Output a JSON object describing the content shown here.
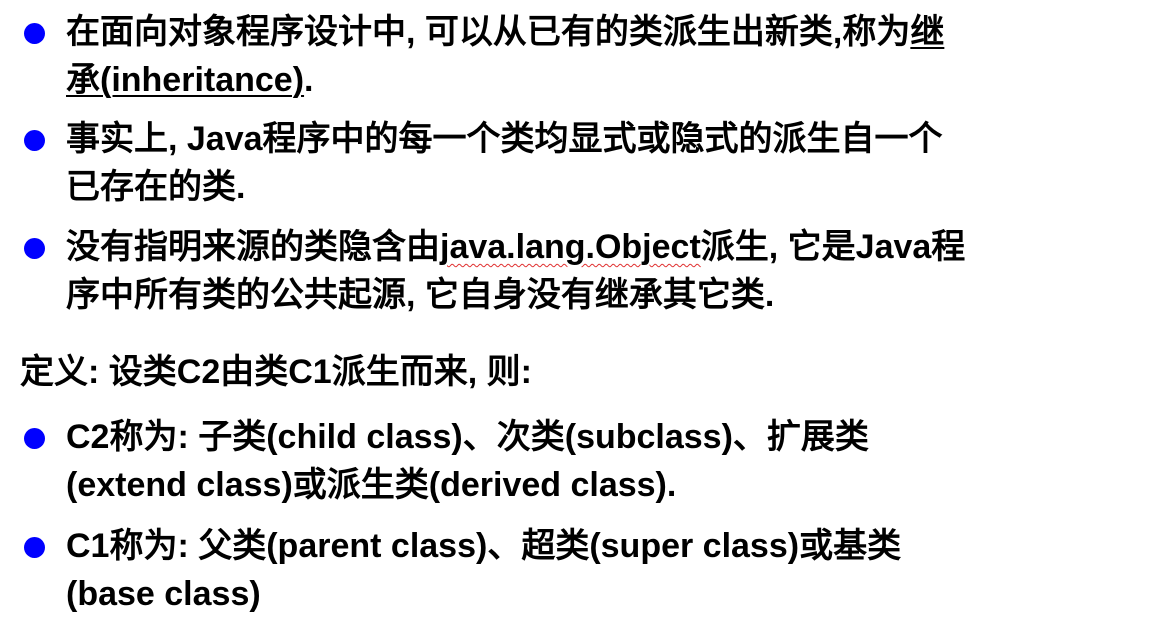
{
  "bullet_color": "#0000ff",
  "wavy_underline_color": "#e03030",
  "bullets_top": [
    {
      "line1_before": "在面向对象程序设计中, 可以从已有的类派生出新类,称为",
      "line1_term": "继",
      "line2_term": "承(inheritance)",
      "line2_after": "."
    },
    {
      "line1": "事实上, Java程序中的每一个类均显式或隐式的派生自一个",
      "line2": "已存在的类."
    },
    {
      "line1_before": "没有指明来源的类隐含由",
      "line1_code": "java.lang.Object",
      "line1_after": "派生, 它是Java程",
      "line2": "序中所有类的公共起源, 它自身没有继承其它类."
    }
  ],
  "definition": "定义: 设类C2由类C1派生而来, 则:",
  "bullets_bottom": [
    {
      "line1": "C2称为: 子类(child class)、次类(subclass)、扩展类",
      "line2": "(extend class)或派生类(derived class)."
    },
    {
      "line1": "C1称为: 父类(parent class)、超类(super class)或基类",
      "line2": "(base class)"
    }
  ]
}
